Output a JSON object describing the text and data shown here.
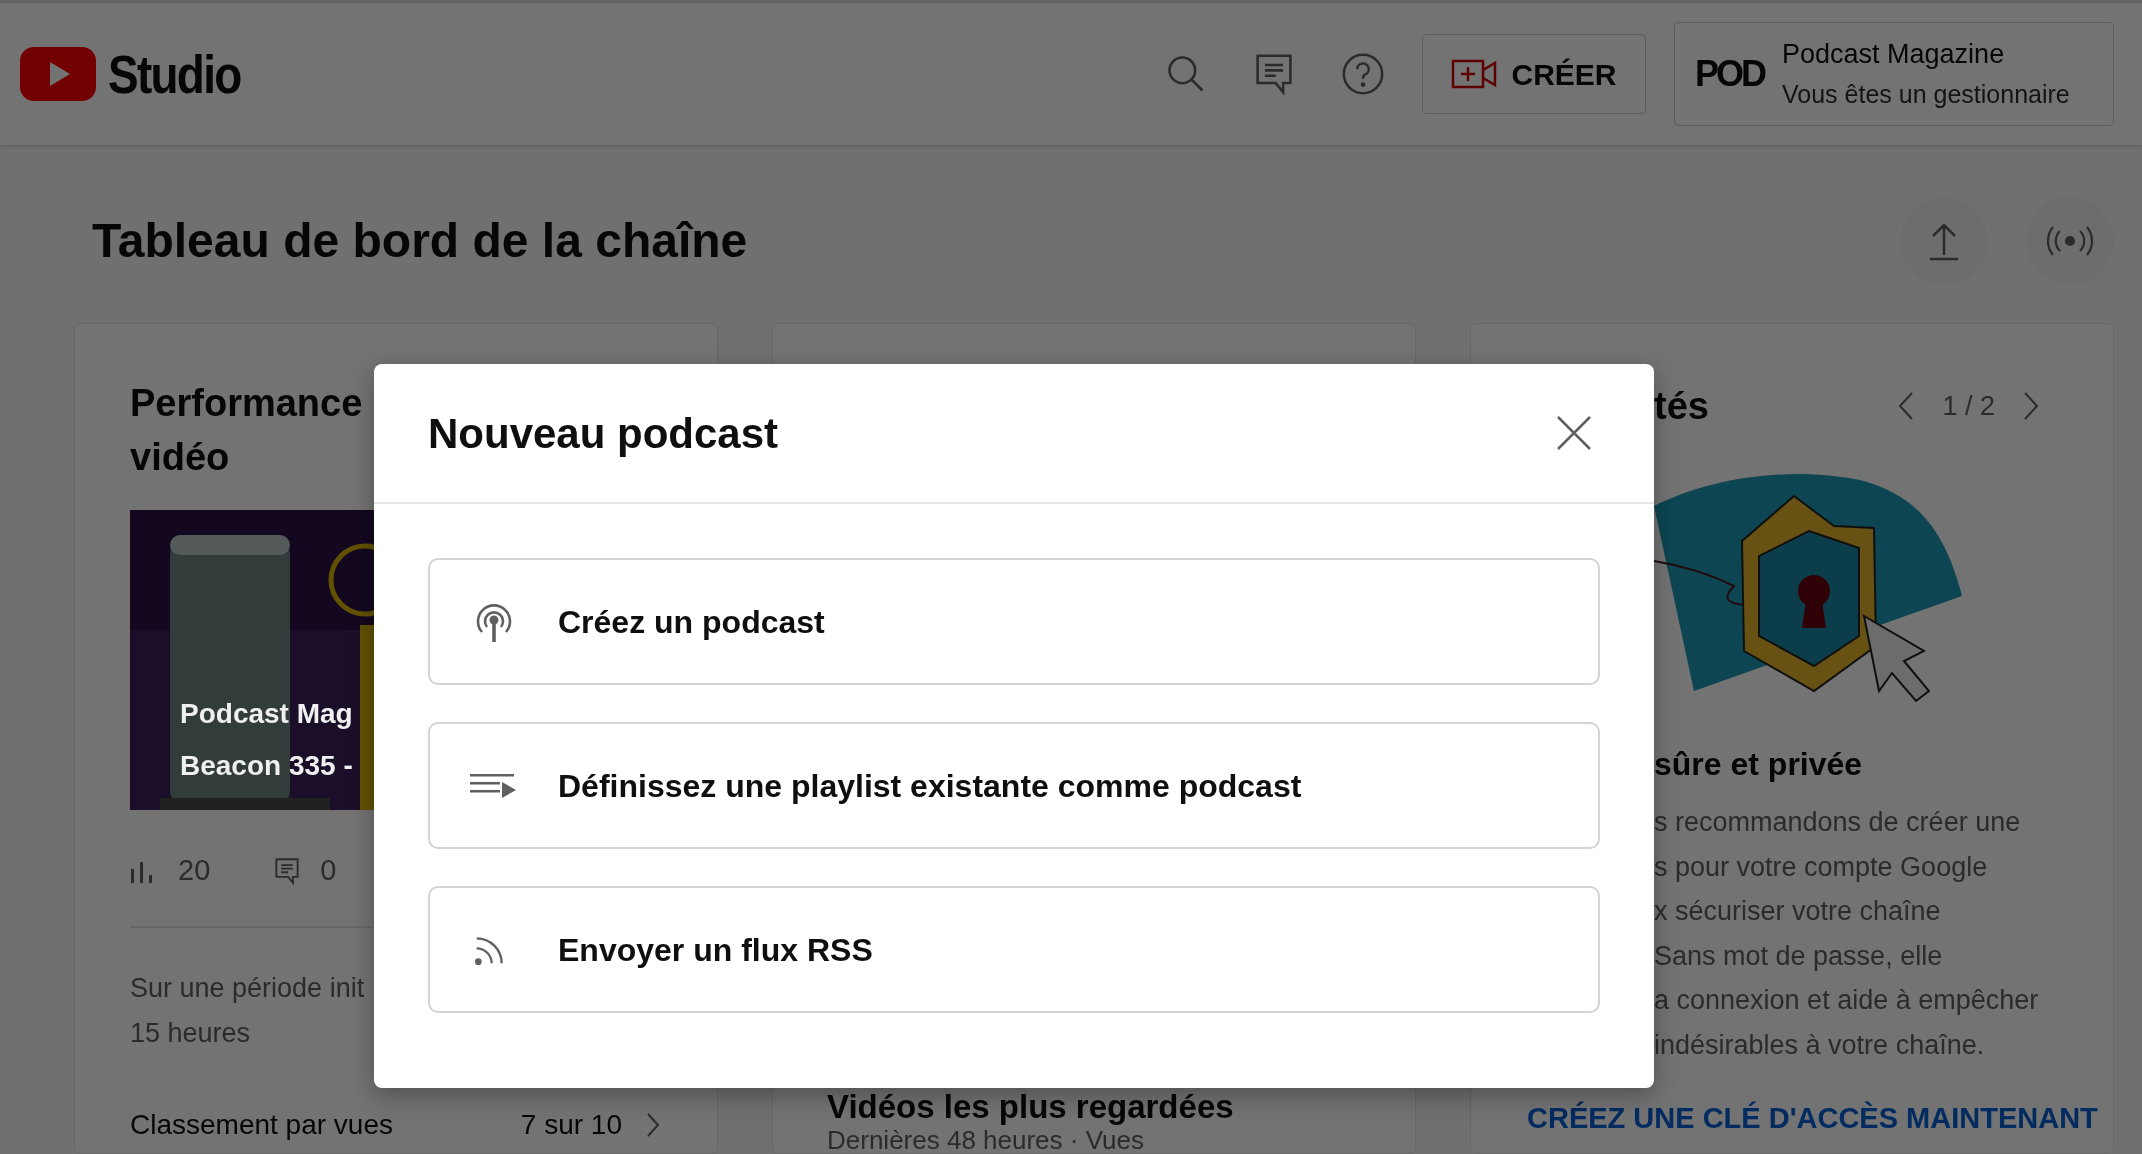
{
  "header": {
    "logo_text": "Studio",
    "create_button": "CRÉER",
    "channel": {
      "logo": "POD",
      "name": "Podcast Magazine",
      "role": "Vous êtes un gestionnaire"
    }
  },
  "page_title": "Tableau de bord de la chaîne",
  "performance_card": {
    "title_lines": [
      "Performance",
      "vidéo"
    ],
    "thumbnail": {
      "kind": "picture",
      "overlay_lines": [
        "Podcast Mag",
        "Beacon 335 -"
      ]
    },
    "views": "20",
    "comments": "0",
    "period_lines": [
      "Sur une période init",
      "15 heures"
    ],
    "ranking_label": "Classement par vues",
    "ranking_value": "7 sur 10"
  },
  "top_videos_card": {
    "title": "Vidéos les plus regardées",
    "subtitle": "Dernières 48 heures · Vues"
  },
  "news_card": {
    "title": "tés",
    "pager": "1 / 2",
    "heading": "sûre et privée",
    "body_lines": [
      "s recommandons de créer une",
      "s pour votre compte Google",
      "x sécuriser votre chaîne",
      "Sans mot de passe, elle",
      "a connexion et aide à empêcher",
      "indésirables à votre chaîne."
    ],
    "link": "CRÉEZ UNE CLÉ D'ACCÈS MAINTENANT"
  },
  "modal": {
    "title": "Nouveau podcast",
    "options": [
      {
        "kind": "podcast",
        "label": "Créez un podcast"
      },
      {
        "kind": "playlist",
        "label": "Définissez une playlist existante comme podcast"
      },
      {
        "kind": "rss",
        "label": "Envoyer un flux RSS"
      }
    ]
  }
}
